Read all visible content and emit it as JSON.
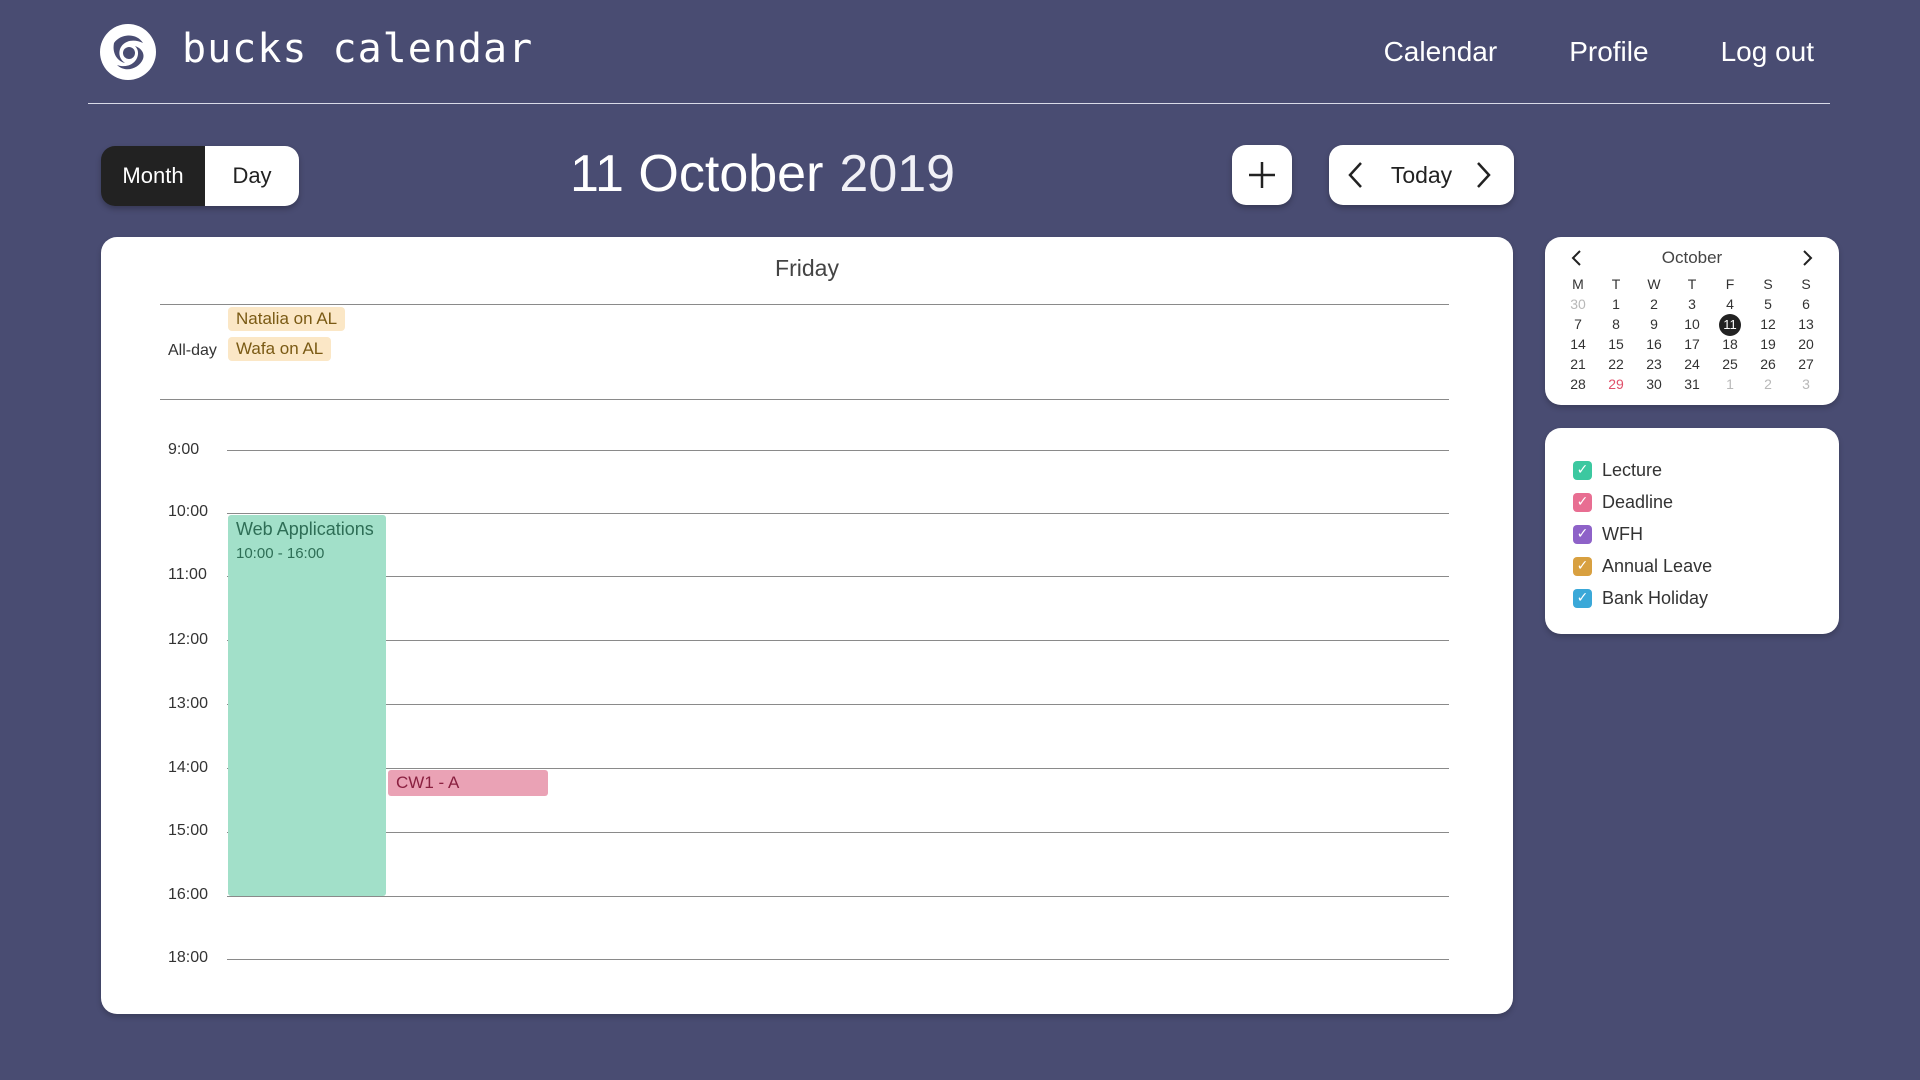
{
  "brand": {
    "name": "bucks calendar"
  },
  "nav": {
    "calendar": "Calendar",
    "profile": "Profile",
    "logout": "Log out"
  },
  "view_toggle": {
    "month": "Month",
    "day": "Day",
    "active": "Month"
  },
  "date_heading": {
    "day_month": "11 October",
    "year": "2019"
  },
  "today_nav": {
    "today": "Today"
  },
  "day_view": {
    "day_name": "Friday",
    "allday_label": "All-day",
    "allday_events": [
      "Natalia on AL",
      "Wafa on AL"
    ],
    "times": [
      "9:00",
      "10:00",
      "11:00",
      "12:00",
      "13:00",
      "14:00",
      "15:00",
      "16:00",
      "18:00"
    ],
    "events": [
      {
        "title": "Web Applications",
        "time": "10:00 - 16:00",
        "category": "Lecture"
      },
      {
        "title": "CW1 - A",
        "category": "Deadline"
      }
    ]
  },
  "mini_calendar": {
    "month": "October",
    "weekdays": [
      "M",
      "T",
      "W",
      "T",
      "F",
      "S",
      "S"
    ],
    "weeks": [
      [
        "30",
        "1",
        "2",
        "3",
        "4",
        "5",
        "6"
      ],
      [
        "7",
        "8",
        "9",
        "10",
        "11",
        "12",
        "13"
      ],
      [
        "14",
        "15",
        "16",
        "17",
        "18",
        "19",
        "20"
      ],
      [
        "21",
        "22",
        "23",
        "24",
        "25",
        "26",
        "27"
      ],
      [
        "28",
        "29",
        "30",
        "31",
        "1",
        "2",
        "3"
      ]
    ],
    "selected": "11",
    "holiday": "29"
  },
  "legend": {
    "items": [
      {
        "label": "Lecture",
        "color": "#3cc8a0",
        "checked": true
      },
      {
        "label": "Deadline",
        "color": "#e86e92",
        "checked": true
      },
      {
        "label": "WFH",
        "color": "#8e62c8",
        "checked": true
      },
      {
        "label": "Annual Leave",
        "color": "#d8a040",
        "checked": true
      },
      {
        "label": "Bank Holiday",
        "color": "#3aa8d8",
        "checked": true
      }
    ]
  },
  "colors": {
    "background": "#494c72",
    "lecture_bg": "#a2e0c9",
    "deadline_bg": "#eaa2b5",
    "annual_leave_bg": "#fbe7c6"
  }
}
